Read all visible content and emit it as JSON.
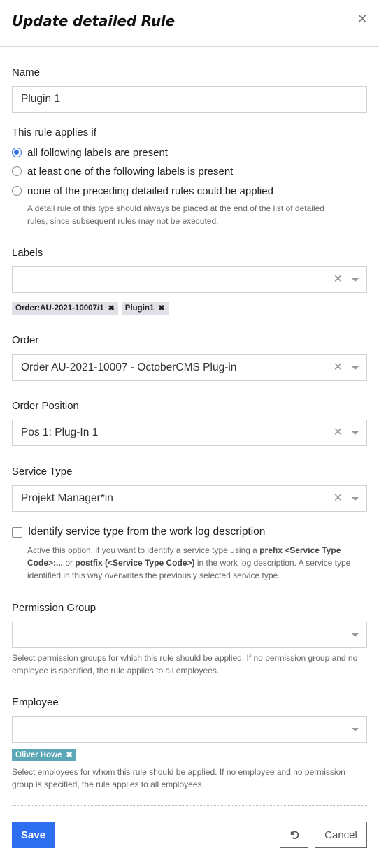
{
  "dialog": {
    "title": "Update detailed Rule",
    "close_icon": "close-icon"
  },
  "name_field": {
    "label": "Name",
    "value": "Plugin 1"
  },
  "applies_if": {
    "label": "This rule applies if",
    "options": [
      {
        "label": "all following labels are present",
        "checked": true
      },
      {
        "label": "at least one of the following labels is present",
        "checked": false
      },
      {
        "label": "none of the preceding detailed rules could be applied",
        "checked": false
      }
    ],
    "help_line1": "A detail rule of this type should always be placed at the end of the list of detailed",
    "help_line2": "rules, since subsequent rules may not be executed."
  },
  "labels_field": {
    "label": "Labels",
    "value": "",
    "tags": [
      "Order:AU-2021-10007/1",
      "Plugin1"
    ]
  },
  "order_field": {
    "label": "Order",
    "value": "Order AU-2021-10007 - OctoberCMS Plug-in"
  },
  "order_position_field": {
    "label": "Order Position",
    "value": "Pos 1: Plug-In 1"
  },
  "service_type_field": {
    "label": "Service Type",
    "value": "Projekt Manager*in"
  },
  "identify_checkbox": {
    "label": "Identify service type from the work log description",
    "checked": false,
    "help": {
      "t1": "Active this option, if you want to identify a service type using a ",
      "b1": "prefix <Service Type Code>:...",
      "t2": " or ",
      "b2": "postfix (<Service Type Code>)",
      "t3": " in the work log description. A service type identified in this way overwrites the previously selected service type."
    }
  },
  "permission_group_field": {
    "label": "Permission Group",
    "value": "",
    "help": "Select permission groups for which this rule should be applied. If no permission group and no employee is specified, the rule applies to all employees."
  },
  "employee_field": {
    "label": "Employee",
    "value": "",
    "tags": [
      "Oliver Howe"
    ],
    "help": "Select employees for whom this rule should be applied. If no employee and no permission group is specified, the rule applies to all employees."
  },
  "footer": {
    "save_label": "Save",
    "reset_icon": "reset-icon",
    "cancel_label": "Cancel"
  },
  "colors": {
    "primary": "#2d6ff0",
    "radio_checked": "#2f74e8",
    "tag_gray": "#dfe1e6",
    "tag_teal": "#5ba7b6"
  }
}
